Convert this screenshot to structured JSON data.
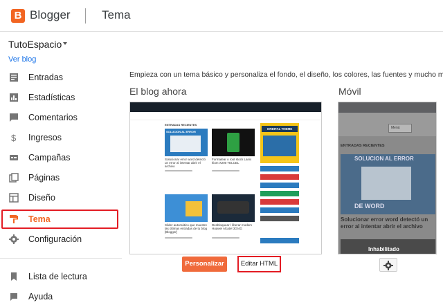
{
  "header": {
    "brand": "Blogger",
    "section": "Tema",
    "logo_letter": "B",
    "accent": "#f26522"
  },
  "blog": {
    "name": "TutoEspacio",
    "view_link": "Ver blog"
  },
  "sidebar": {
    "items": [
      {
        "label": "Entradas",
        "icon": "posts-icon"
      },
      {
        "label": "Estadísticas",
        "icon": "stats-icon"
      },
      {
        "label": "Comentarios",
        "icon": "comments-icon"
      },
      {
        "label": "Ingresos",
        "icon": "dollar-icon"
      },
      {
        "label": "Campañas",
        "icon": "campaigns-icon"
      },
      {
        "label": "Páginas",
        "icon": "pages-icon"
      },
      {
        "label": "Diseño",
        "icon": "layout-icon"
      },
      {
        "label": "Tema",
        "icon": "theme-roller-icon",
        "active": true
      },
      {
        "label": "Configuración",
        "icon": "gear-icon"
      }
    ],
    "bottom_items": [
      {
        "label": "Lista de lectura",
        "icon": "bookmark-icon"
      },
      {
        "label": "Ayuda",
        "icon": "help-icon"
      }
    ]
  },
  "main": {
    "intro": "Empieza con un tema básico y personaliza el fondo, el diseño, los colores, las fuentes y mucho más...",
    "current_heading": "El blog ahora",
    "mobile_heading": "Móvil",
    "customize_button": "Personalizar",
    "edit_html_button": "Editar HTML"
  },
  "preview": {
    "section_label": "ENTRADAS RECIENTES",
    "sidebar_banner": "ORBITAL THEME",
    "posts": [
      {
        "title": "Solucionar error word detectó un error al intentar abrir el archivo"
      },
      {
        "title": "Formatear o root stock Lanix Ilium X200 TELCEL"
      },
      {
        "title": "Slider automático que muestre las últimas entradas de tu blog [Blogger]"
      },
      {
        "title": "Desbloquear / liberar modem Huawei Alcatel 3G/4G"
      }
    ],
    "thumb_text_1": "SOLUCION AL ERROR",
    "thumb_text_2": "DE WORD"
  },
  "mobile_preview": {
    "section_label": "ENTRADAS RECIENTES",
    "select_label": "Menú",
    "image_text_1": "SOLUCION AL ERROR",
    "image_text_2": "DE WORD",
    "post_title": "Solucionar error word detectó un error al intentar abrir el archivo",
    "bottom_text": "Inhabilitado"
  }
}
